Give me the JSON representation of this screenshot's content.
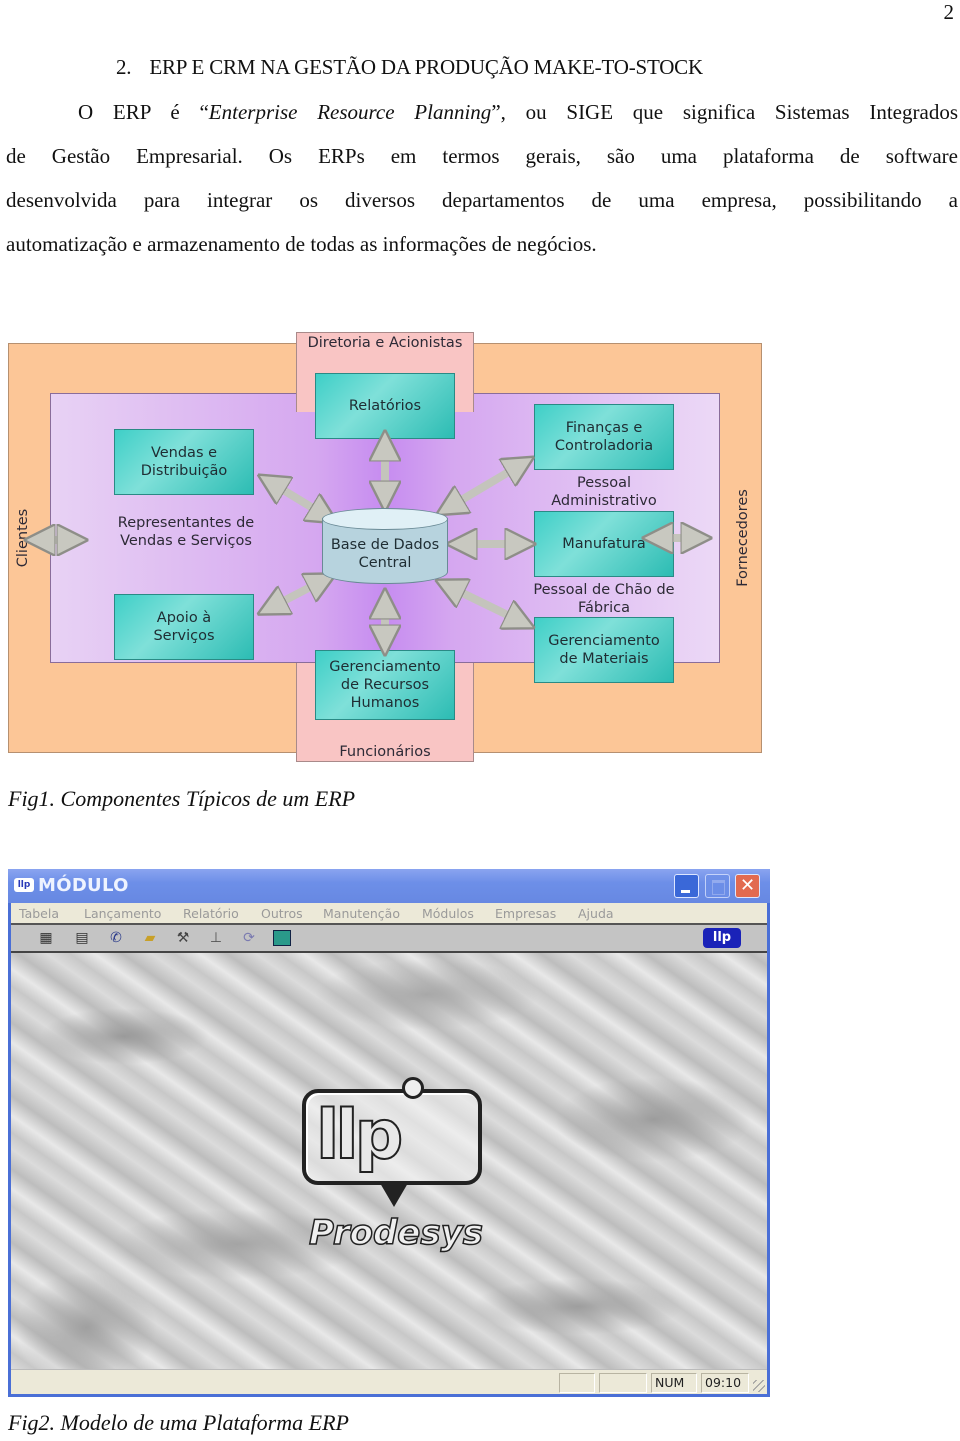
{
  "page_number": "2",
  "section": {
    "number": "2.",
    "title": "ERP E CRM NA GESTÃO DA PRODUÇÃO MAKE-TO-STOCK"
  },
  "paragraph": {
    "line1_pre": "O ERP é “",
    "line1_italic": "Enterprise Resource Planning",
    "line1_post": "”, ou SIGE que significa Sistemas Integrados",
    "line2": "de Gestão Empresarial. Os ERPs em termos gerais, são uma plataforma de software",
    "line3": "desenvolvida para integrar os diversos departamentos de uma empresa, possibilitando a",
    "line4": "automatização e armazenamento de todas as informações de negócios."
  },
  "figure1": {
    "caption": "Fig1. Componentes Típicos de um ERP",
    "top_group": "Diretoria e Acionistas",
    "bottom_group": "Funcionários",
    "left_group": "Clientes",
    "right_group": "Fornecedores",
    "central_database": "Base de Dados Central",
    "modules": {
      "reports": "Relatórios",
      "sales_distribution": "Vendas e Distribuição",
      "service_support": "Apoio à Serviços",
      "finance_control": "Finanças e Controladoria",
      "manufacturing": "Manufatura",
      "materials_management": "Gerenciamento de Materiais",
      "hr_management": "Gerenciamento de Recursos Humanos"
    },
    "people_labels": {
      "sales_reps": "Representantes de Vendas e Serviços",
      "admin_staff": "Pessoal Administrativo",
      "floor_staff": "Pessoal de Chão de Fábrica"
    }
  },
  "figure2": {
    "caption": "Fig2. Modelo de uma Plataforma ERP",
    "window": {
      "title": "MÓDULO",
      "app_icon": "llp-logo-icon",
      "menu": [
        "Tabela",
        "Lançamento",
        "Relatório",
        "Outros",
        "Manutenção",
        "Módulos",
        "Empresas",
        "Ajuda"
      ],
      "toolbar_icons": [
        "table-icon",
        "card-file-icon",
        "phone-book-icon",
        "open-folder-icon",
        "tools-icon",
        "org-chart-icon",
        "cycle-icon",
        "exit-door-icon"
      ],
      "toolbar_logo": "llp",
      "splash_brand": "Prodesys",
      "splash_logo_letters": "llp",
      "status": {
        "cell1": "",
        "cell2": "",
        "num_lock": "NUM",
        "clock": "09:10"
      }
    }
  }
}
